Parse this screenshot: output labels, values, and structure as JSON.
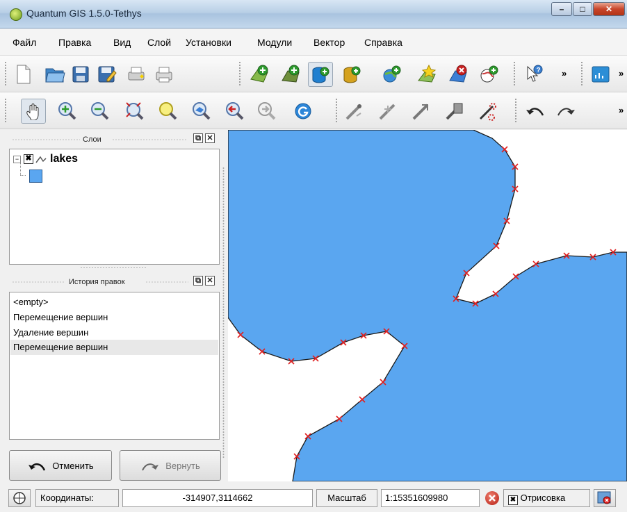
{
  "window": {
    "title": "Quantum GIS 1.5.0-Tethys"
  },
  "menu": [
    "Файл",
    "Правка",
    "Вид",
    "Слой",
    "Установки",
    "Модули",
    "Вектор",
    "Справка"
  ],
  "panels": {
    "layers": {
      "title": "Слои",
      "layer_name": "lakes",
      "layer_color": "#5aa6f0"
    },
    "history": {
      "title": "История правок",
      "items": [
        "<empty>",
        "Перемещение вершин",
        "Удаление вершин",
        "Перемещение вершин"
      ],
      "selected_index": 3
    }
  },
  "buttons": {
    "undo": "Отменить",
    "redo": "Вернуть"
  },
  "toolbar": {
    "overflow": "»"
  },
  "map": {
    "fill": "#5aa6f0",
    "vertex_color": "#e02020"
  },
  "statusbar": {
    "coords_label": "Координаты:",
    "coords_value": "-314907,3114662",
    "scale_label": "Масштаб",
    "scale_value": "1:15351609980",
    "render_label": "Отрисовка"
  }
}
